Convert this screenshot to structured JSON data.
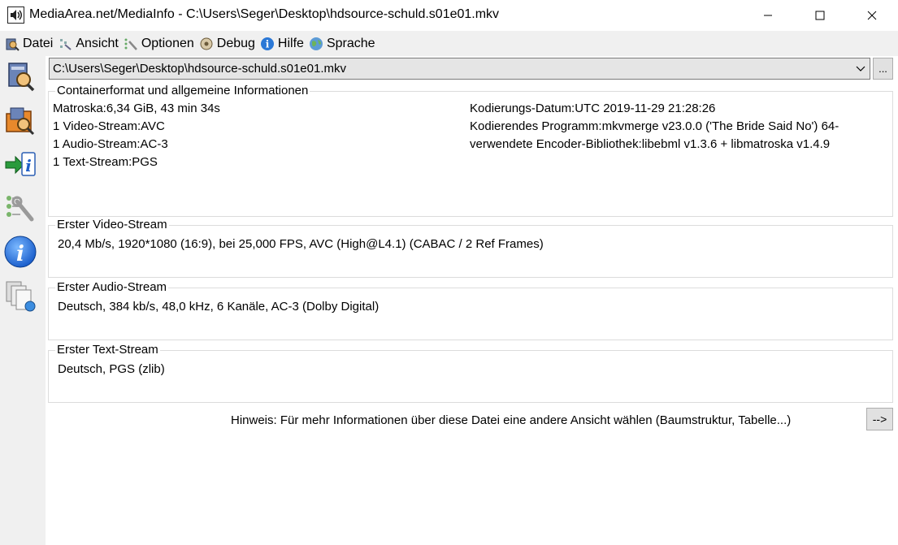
{
  "window": {
    "title": "MediaArea.net/MediaInfo - C:\\Users\\Seger\\Desktop\\hdsource-schuld.s01e01.mkv",
    "icons": {
      "app": "speaker-icon",
      "minimize": "minimize-icon",
      "maximize": "maximize-icon",
      "close": "close-icon"
    }
  },
  "menu": {
    "items": [
      {
        "label": "Datei",
        "icon": "file-open-icon"
      },
      {
        "label": "Ansicht",
        "icon": "view-icon"
      },
      {
        "label": "Optionen",
        "icon": "options-icon"
      },
      {
        "label": "Debug",
        "icon": "debug-icon"
      },
      {
        "label": "Hilfe",
        "icon": "help-icon"
      },
      {
        "label": "Sprache",
        "icon": "globe-icon"
      }
    ]
  },
  "toolbar": {
    "buttons": [
      {
        "name": "open-file-button",
        "icon": "open-file-icon"
      },
      {
        "name": "open-folder-button",
        "icon": "open-folder-icon"
      },
      {
        "name": "export-button",
        "icon": "export-icon"
      },
      {
        "name": "preferences-button",
        "icon": "preferences-icon"
      },
      {
        "name": "about-button",
        "icon": "info-icon"
      },
      {
        "name": "knowledge-base-button",
        "icon": "knowledge-icon"
      }
    ]
  },
  "file": {
    "path": "C:\\Users\\Seger\\Desktop\\hdsource-schuld.s01e01.mkv",
    "browse_label": "..."
  },
  "general": {
    "title": "Containerformat und allgemeine Informationen",
    "left": [
      "Matroska:6,34 GiB, 43 min 34s",
      "1 Video-Stream:AVC",
      "1 Audio-Stream:AC-3",
      "1 Text-Stream:PGS"
    ],
    "right": [
      "Kodierungs-Datum:UTC 2019-11-29 21:28:26",
      "Kodierendes Programm:mkvmerge v23.0.0 ('The Bride Said No') 64-",
      "verwendete Encoder-Bibliothek:libebml v1.3.6 + libmatroska v1.4.9"
    ]
  },
  "video": {
    "title": "Erster Video-Stream",
    "desc": "20,4 Mb/s, 1920*1080 (16:9), bei 25,000 FPS, AVC (High@L4.1) (CABAC / 2 Ref Frames)"
  },
  "audio": {
    "title": "Erster Audio-Stream",
    "desc": "Deutsch, 384 kb/s, 48,0 kHz, 6 Kanäle, AC-3 (Dolby Digital)"
  },
  "text": {
    "title": "Erster Text-Stream",
    "desc": "Deutsch, PGS (zlib)"
  },
  "hint": {
    "text": "Hinweis: Für mehr Informationen über diese Datei eine andere Ansicht wählen (Baumstruktur, Tabelle...)",
    "button_label": "-->"
  }
}
